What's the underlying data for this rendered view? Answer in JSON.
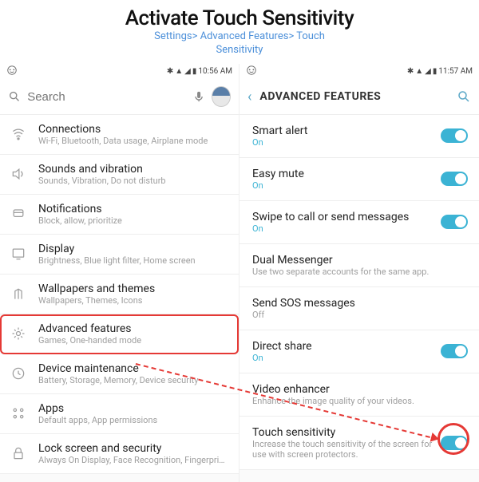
{
  "header": {
    "title": "Activate Touch Sensitivity",
    "breadcrumb_line1": "Settings> Advanced Features> Touch",
    "breadcrumb_line2": "Sensitivity"
  },
  "phone_left": {
    "status": {
      "time": "10:56 AM"
    },
    "search": {
      "placeholder": "Search"
    },
    "items": [
      {
        "icon": "connections-icon",
        "title": "Connections",
        "sub": "Wi-Fi, Bluetooth, Data usage, Airplane mode"
      },
      {
        "icon": "sound-icon",
        "title": "Sounds and vibration",
        "sub": "Sounds, Vibration, Do not disturb"
      },
      {
        "icon": "notifications-icon",
        "title": "Notifications",
        "sub": "Block, allow, prioritize"
      },
      {
        "icon": "display-icon",
        "title": "Display",
        "sub": "Brightness, Blue light filter, Home screen"
      },
      {
        "icon": "wallpaper-icon",
        "title": "Wallpapers and themes",
        "sub": "Wallpapers, Themes, Icons"
      },
      {
        "icon": "advanced-icon",
        "title": "Advanced features",
        "sub": "Games, One-handed mode"
      },
      {
        "icon": "maintenance-icon",
        "title": "Device maintenance",
        "sub": "Battery, Storage, Memory, Device security"
      },
      {
        "icon": "apps-icon",
        "title": "Apps",
        "sub": "Default apps, App permissions"
      },
      {
        "icon": "lock-icon",
        "title": "Lock screen and security",
        "sub": "Always On Display, Face Recognition, Fingerprints, Iris"
      }
    ]
  },
  "phone_right": {
    "status": {
      "time": "11:57 AM"
    },
    "header": {
      "title": "ADVANCED FEATURES"
    },
    "items": [
      {
        "title": "Smart alert",
        "sub": "On",
        "sub_on": true,
        "toggle": true,
        "toggled": true
      },
      {
        "title": "Easy mute",
        "sub": "On",
        "sub_on": true,
        "toggle": true,
        "toggled": true
      },
      {
        "title": "Swipe to call or send messages",
        "sub": "On",
        "sub_on": true,
        "toggle": true,
        "toggled": true
      },
      {
        "title": "Dual Messenger",
        "sub": "Use two separate accounts for the same app.",
        "sub_on": false,
        "toggle": false
      },
      {
        "title": "Send SOS messages",
        "sub": "Off",
        "sub_on": false,
        "toggle": false
      },
      {
        "title": "Direct share",
        "sub": "On",
        "sub_on": true,
        "toggle": true,
        "toggled": true
      },
      {
        "title": "Video enhancer",
        "sub": "Enhance the image quality of your videos.",
        "sub_on": false,
        "toggle": false
      },
      {
        "title": "Touch sensitivity",
        "sub": "Increase the touch sensitivity of the screen for use with screen protectors.",
        "sub_on": false,
        "toggle": true,
        "toggled": true
      }
    ]
  }
}
